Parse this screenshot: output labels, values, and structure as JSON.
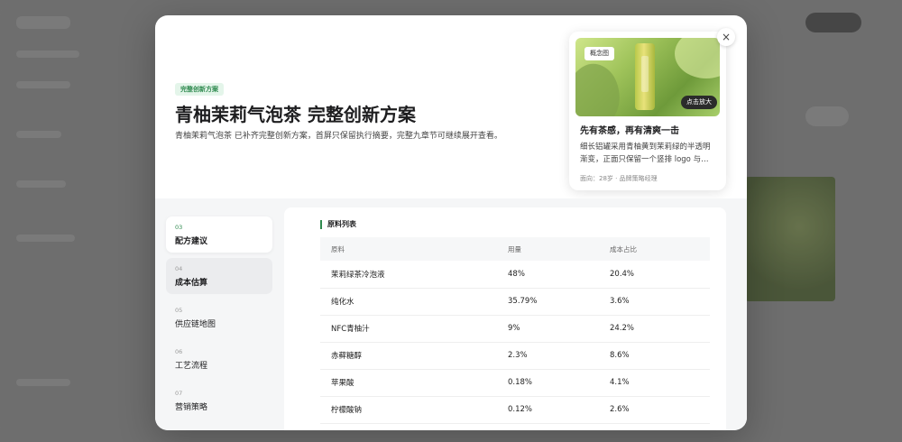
{
  "modal": {
    "close_icon": "×",
    "hero": {
      "badge": "完整创新方案",
      "title": "青柚茉莉气泡茶 完整创新方案",
      "subtitle": "青柚茉莉气泡茶 已补齐完整创新方案，首屏只保留执行摘要，完整九章节可继续展开查看。"
    },
    "concept_card": {
      "tag": "概念图",
      "zoom_label": "点击放大",
      "title": "先有茶感，再有清爽一击",
      "description": "细长铝罐采用青柚黄到茉莉绿的半透明渐变，正面只保留一个竖排 logo 与…",
      "meta": "面向：28岁 · 品牌策略经理"
    },
    "toc": [
      {
        "num": "03",
        "label": "配方建议",
        "state": "active"
      },
      {
        "num": "04",
        "label": "成本估算",
        "state": "hover"
      },
      {
        "num": "05",
        "label": "供应链地图",
        "state": "normal"
      },
      {
        "num": "06",
        "label": "工艺流程",
        "state": "normal"
      },
      {
        "num": "07",
        "label": "营销策略",
        "state": "normal"
      }
    ],
    "section": {
      "title": "原料列表",
      "columns": [
        "原料",
        "用量",
        "成本占比"
      ],
      "rows": [
        [
          "茉莉绿茶冷泡液",
          "48%",
          "20.4%"
        ],
        [
          "纯化水",
          "35.79%",
          "3.6%"
        ],
        [
          "NFC青柚汁",
          "9%",
          "24.2%"
        ],
        [
          "赤藓糖醇",
          "2.3%",
          "8.6%"
        ],
        [
          "苹果酸",
          "0.18%",
          "4.1%"
        ],
        [
          "柠檬酸钠",
          "0.12%",
          "2.6%"
        ]
      ]
    }
  },
  "colors": {
    "accent": "#2f8a4f",
    "badge_bg": "#e4f5ea"
  }
}
